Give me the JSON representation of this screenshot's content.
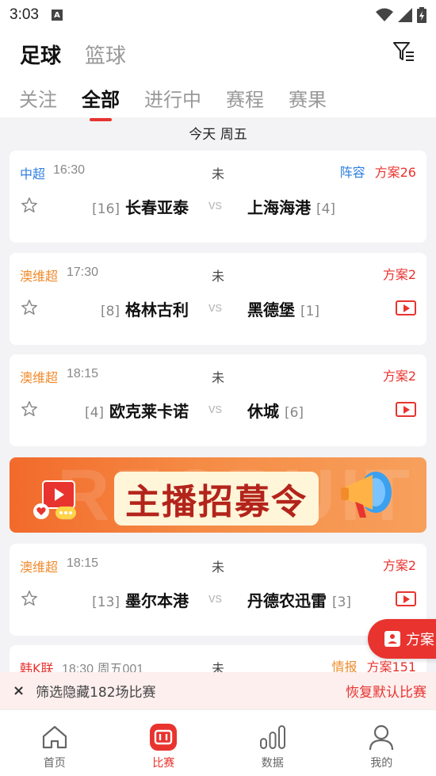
{
  "status_bar": {
    "time": "3:03",
    "a_icon_letter": "A"
  },
  "sport_tabs": [
    {
      "label": "足球",
      "active": true
    },
    {
      "label": "篮球",
      "active": false
    }
  ],
  "sub_tabs": [
    {
      "label": "关注",
      "active": false
    },
    {
      "label": "全部",
      "active": true
    },
    {
      "label": "进行中",
      "active": false
    },
    {
      "label": "赛程",
      "active": false
    },
    {
      "label": "赛果",
      "active": false
    }
  ],
  "date_label": "今天 周五",
  "vs_label": "vs",
  "matches": [
    {
      "league": "中超",
      "league_color": "#2f7fe0",
      "time": "16:30",
      "status": "未",
      "lineup_label": "阵容",
      "plan_label": "方案26",
      "home_rank": "[16]",
      "home": "长春亚泰",
      "away": "上海海港",
      "away_rank": "[4]"
    },
    {
      "league": "澳维超",
      "league_color": "#ef8a2a",
      "time": "17:30",
      "status": "未",
      "plan_label": "方案2",
      "home_rank": "[8]",
      "home": "格林古利",
      "away": "黑德堡",
      "away_rank": "[1]"
    },
    {
      "league": "澳维超",
      "league_color": "#ef8a2a",
      "time": "18:15",
      "status": "未",
      "plan_label": "方案2",
      "home_rank": "[4]",
      "home": "欧克莱卡诺",
      "away": "休城",
      "away_rank": "[6]"
    },
    {
      "league": "澳维超",
      "league_color": "#ef8a2a",
      "time": "18:15",
      "status": "未",
      "plan_label": "方案2",
      "home_rank": "[13]",
      "home": "墨尔本港",
      "away": "丹德农迅雷",
      "away_rank": "[3]"
    },
    {
      "league": "韩K联",
      "league_color": "#e8332f",
      "time": "18:30",
      "weekday_code": "周五001",
      "status": "未",
      "intel_label": "情报",
      "plan_label": "方案151"
    }
  ],
  "banner": {
    "title": "主播招募令",
    "bg_word": "RECRUIT"
  },
  "float_button": {
    "label": "方案"
  },
  "filter_bar": {
    "message": "筛选隐藏182场比赛",
    "restore_label": "恢复默认比赛",
    "close_symbol": "×"
  },
  "bottom_nav": [
    {
      "label": "首页",
      "icon": "home-icon",
      "active": false
    },
    {
      "label": "比赛",
      "icon": "match-icon",
      "active": true
    },
    {
      "label": "数据",
      "icon": "data-icon",
      "active": false
    },
    {
      "label": "我的",
      "icon": "profile-icon",
      "active": false
    }
  ],
  "colors": {
    "accent": "#e8332f",
    "blue": "#2f7fe0",
    "orange": "#ef8a2a"
  }
}
